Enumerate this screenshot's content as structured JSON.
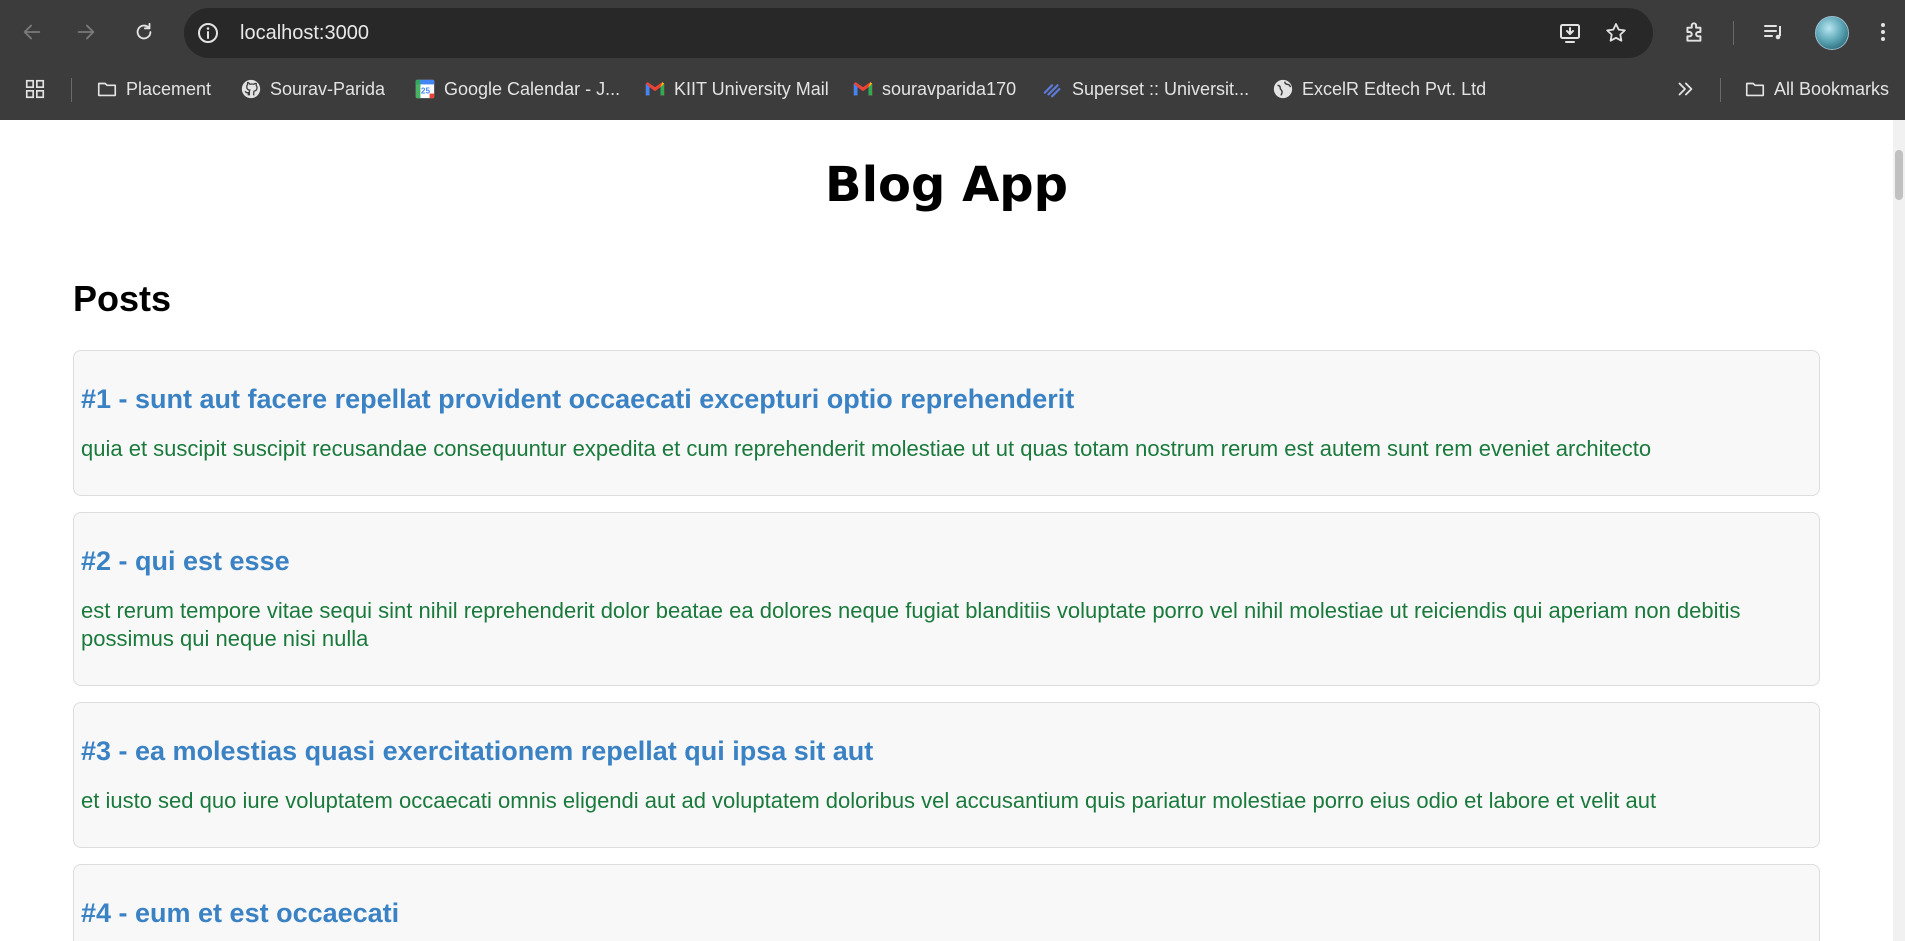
{
  "browser": {
    "url": "localhost:3000",
    "bookmarks": [
      {
        "label": "Placement",
        "icon": "folder-icon"
      },
      {
        "label": "Sourav-Parida",
        "icon": "github-icon"
      },
      {
        "label": "Google Calendar - J...",
        "icon": "calendar-icon"
      },
      {
        "label": "KIIT University Mail",
        "icon": "gmail-icon"
      },
      {
        "label": "souravparida170",
        "icon": "gmail-icon"
      },
      {
        "label": "Superset :: Universit...",
        "icon": "superset-icon"
      },
      {
        "label": "ExcelR Edtech Pvt. Ltd",
        "icon": "globe-icon"
      }
    ],
    "all_bookmarks_label": "All Bookmarks",
    "calendar_day": "25"
  },
  "app": {
    "title": "Blog App",
    "section_title": "Posts",
    "posts": [
      {
        "title": "#1 - sunt aut facere repellat provident occaecati excepturi optio reprehenderit",
        "body": "quia et suscipit suscipit recusandae consequuntur expedita et cum reprehenderit molestiae ut ut quas totam nostrum rerum est autem sunt rem eveniet architecto"
      },
      {
        "title": "#2 - qui est esse",
        "body": "est rerum tempore vitae sequi sint nihil reprehenderit dolor beatae ea dolores neque fugiat blanditiis voluptate porro vel nihil molestiae ut reiciendis qui aperiam non debitis possimus qui neque nisi nulla"
      },
      {
        "title": "#3 - ea molestias quasi exercitationem repellat qui ipsa sit aut",
        "body": "et iusto sed quo iure voluptatem occaecati omnis eligendi aut ad voluptatem doloribus vel accusantium quis pariatur molestiae porro eius odio et labore et velit aut"
      },
      {
        "title": "#4 - eum et est occaecati",
        "body": ""
      }
    ]
  },
  "colors": {
    "chrome_bg": "#3c3c3c",
    "omnibox_bg": "#282828",
    "post_title": "#3a82c4",
    "post_body": "#1a7a3c",
    "card_bg": "#f8f8f8"
  }
}
